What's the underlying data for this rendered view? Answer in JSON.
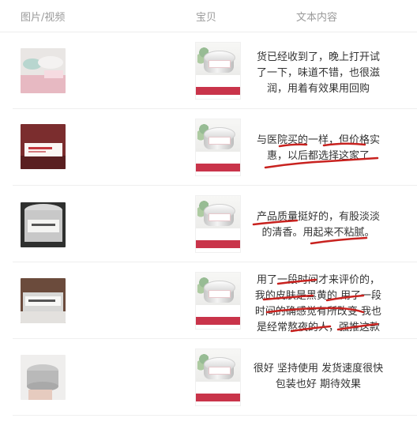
{
  "header": {
    "media_label": "图片/视频",
    "product_label": "宝贝",
    "text_label": "文本内容"
  },
  "reviews": [
    {
      "text": "货已经收到了，晚上打开试\n了一下，味道不错，也很滋\n润，用着有效果用回购",
      "photo_icon": "jar-on-pink-icon"
    },
    {
      "text": "与医院买的一样，但价格实\n惠，以后都选择这家了",
      "photo_icon": "product-box-icon"
    },
    {
      "text": "产品质量挺好的，有股淡淡\n的清香。用起来不粘腻。",
      "photo_icon": "jar-closeup-icon"
    },
    {
      "text": "用了一段时间才来评价的，\n我的皮肤是黑黄的 用了一段\n时间的确感觉有所改变 我也\n是经常熬夜的人，强推这款",
      "photo_icon": "two-jars-icon"
    },
    {
      "text": "很好 坚持使用 发货速度很快\n包装也好 期待效果",
      "photo_icon": "jar-in-hand-icon"
    }
  ],
  "colors": {
    "annotation": "#c8221f",
    "banner": "#c9344a"
  }
}
